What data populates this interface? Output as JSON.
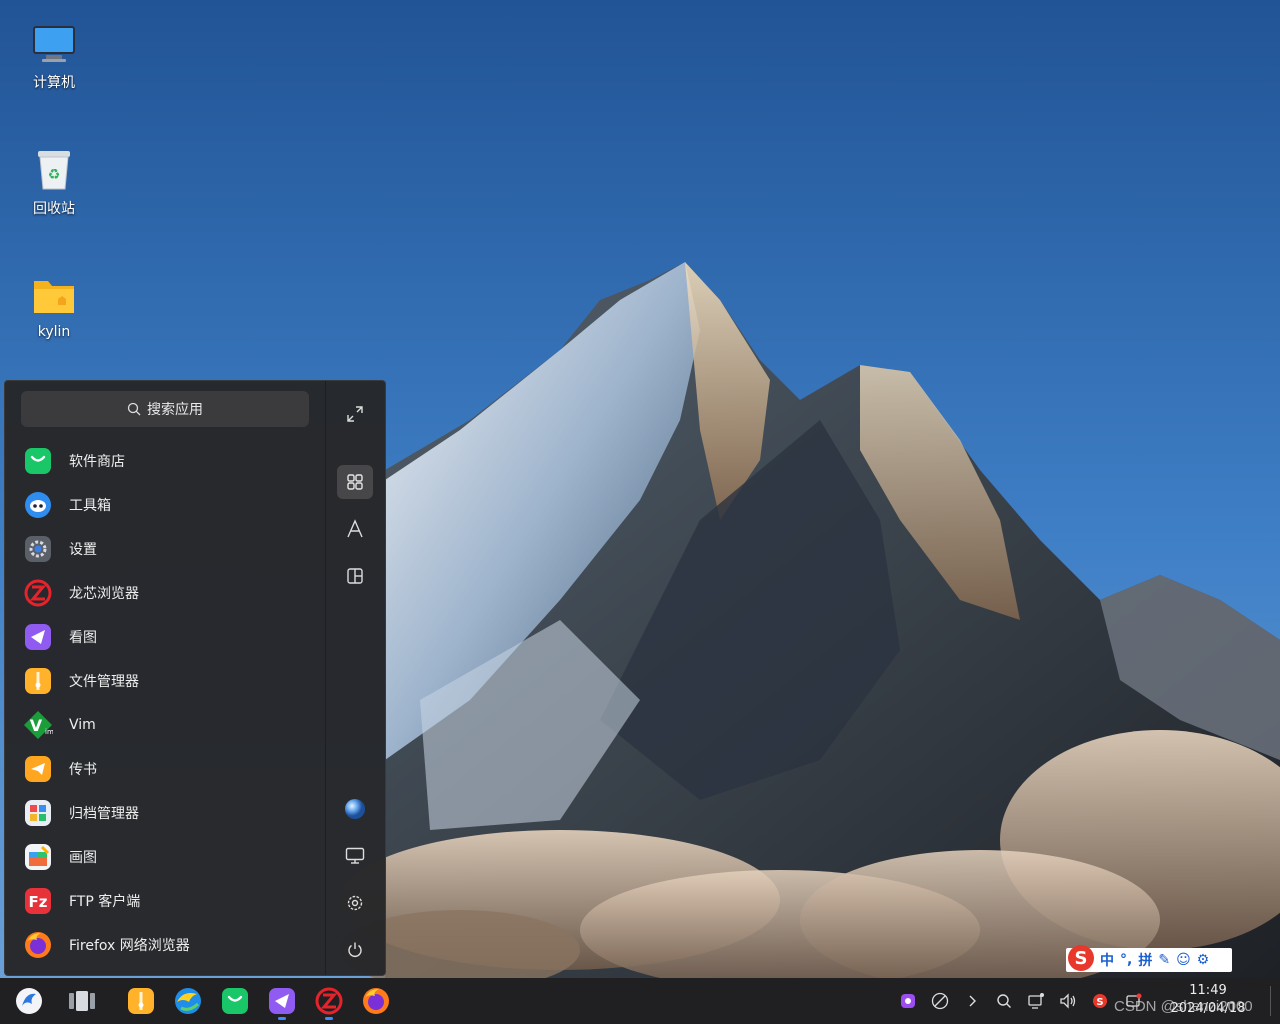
{
  "desktop": {
    "icons": [
      {
        "label": "计算机"
      },
      {
        "label": "回收站"
      },
      {
        "label": "kylin"
      }
    ]
  },
  "start_menu": {
    "search_placeholder": "搜索应用",
    "apps": [
      {
        "label": "软件商店",
        "icon": "software-store-icon"
      },
      {
        "label": "工具箱",
        "icon": "toolbox-icon"
      },
      {
        "label": "设置",
        "icon": "settings-icon"
      },
      {
        "label": "龙芯浏览器",
        "icon": "loongson-browser-icon"
      },
      {
        "label": "看图",
        "icon": "image-viewer-icon"
      },
      {
        "label": "文件管理器",
        "icon": "file-manager-icon"
      },
      {
        "label": "Vim",
        "icon": "vim-icon"
      },
      {
        "label": "传书",
        "icon": "file-transfer-icon"
      },
      {
        "label": "归档管理器",
        "icon": "archive-manager-icon"
      },
      {
        "label": "画图",
        "icon": "paint-icon"
      },
      {
        "label": "FTP 客户端",
        "icon": "ftp-client-icon"
      },
      {
        "label": "Firefox 网络浏览器",
        "icon": "firefox-icon"
      }
    ],
    "sidebar": [
      "fullscreen-icon",
      "all-apps-icon",
      "letter-sort-icon",
      "category-icon",
      "user-avatar-icon",
      "computer-icon",
      "gear-icon",
      "power-icon"
    ]
  },
  "ime": {
    "mode": "中",
    "punct": "°,",
    "pinyin": "拼"
  },
  "taskbar": {
    "clock_time": "11:49",
    "clock_date": "2024/04/18"
  },
  "watermark": "CSDN @shenzi2000"
}
